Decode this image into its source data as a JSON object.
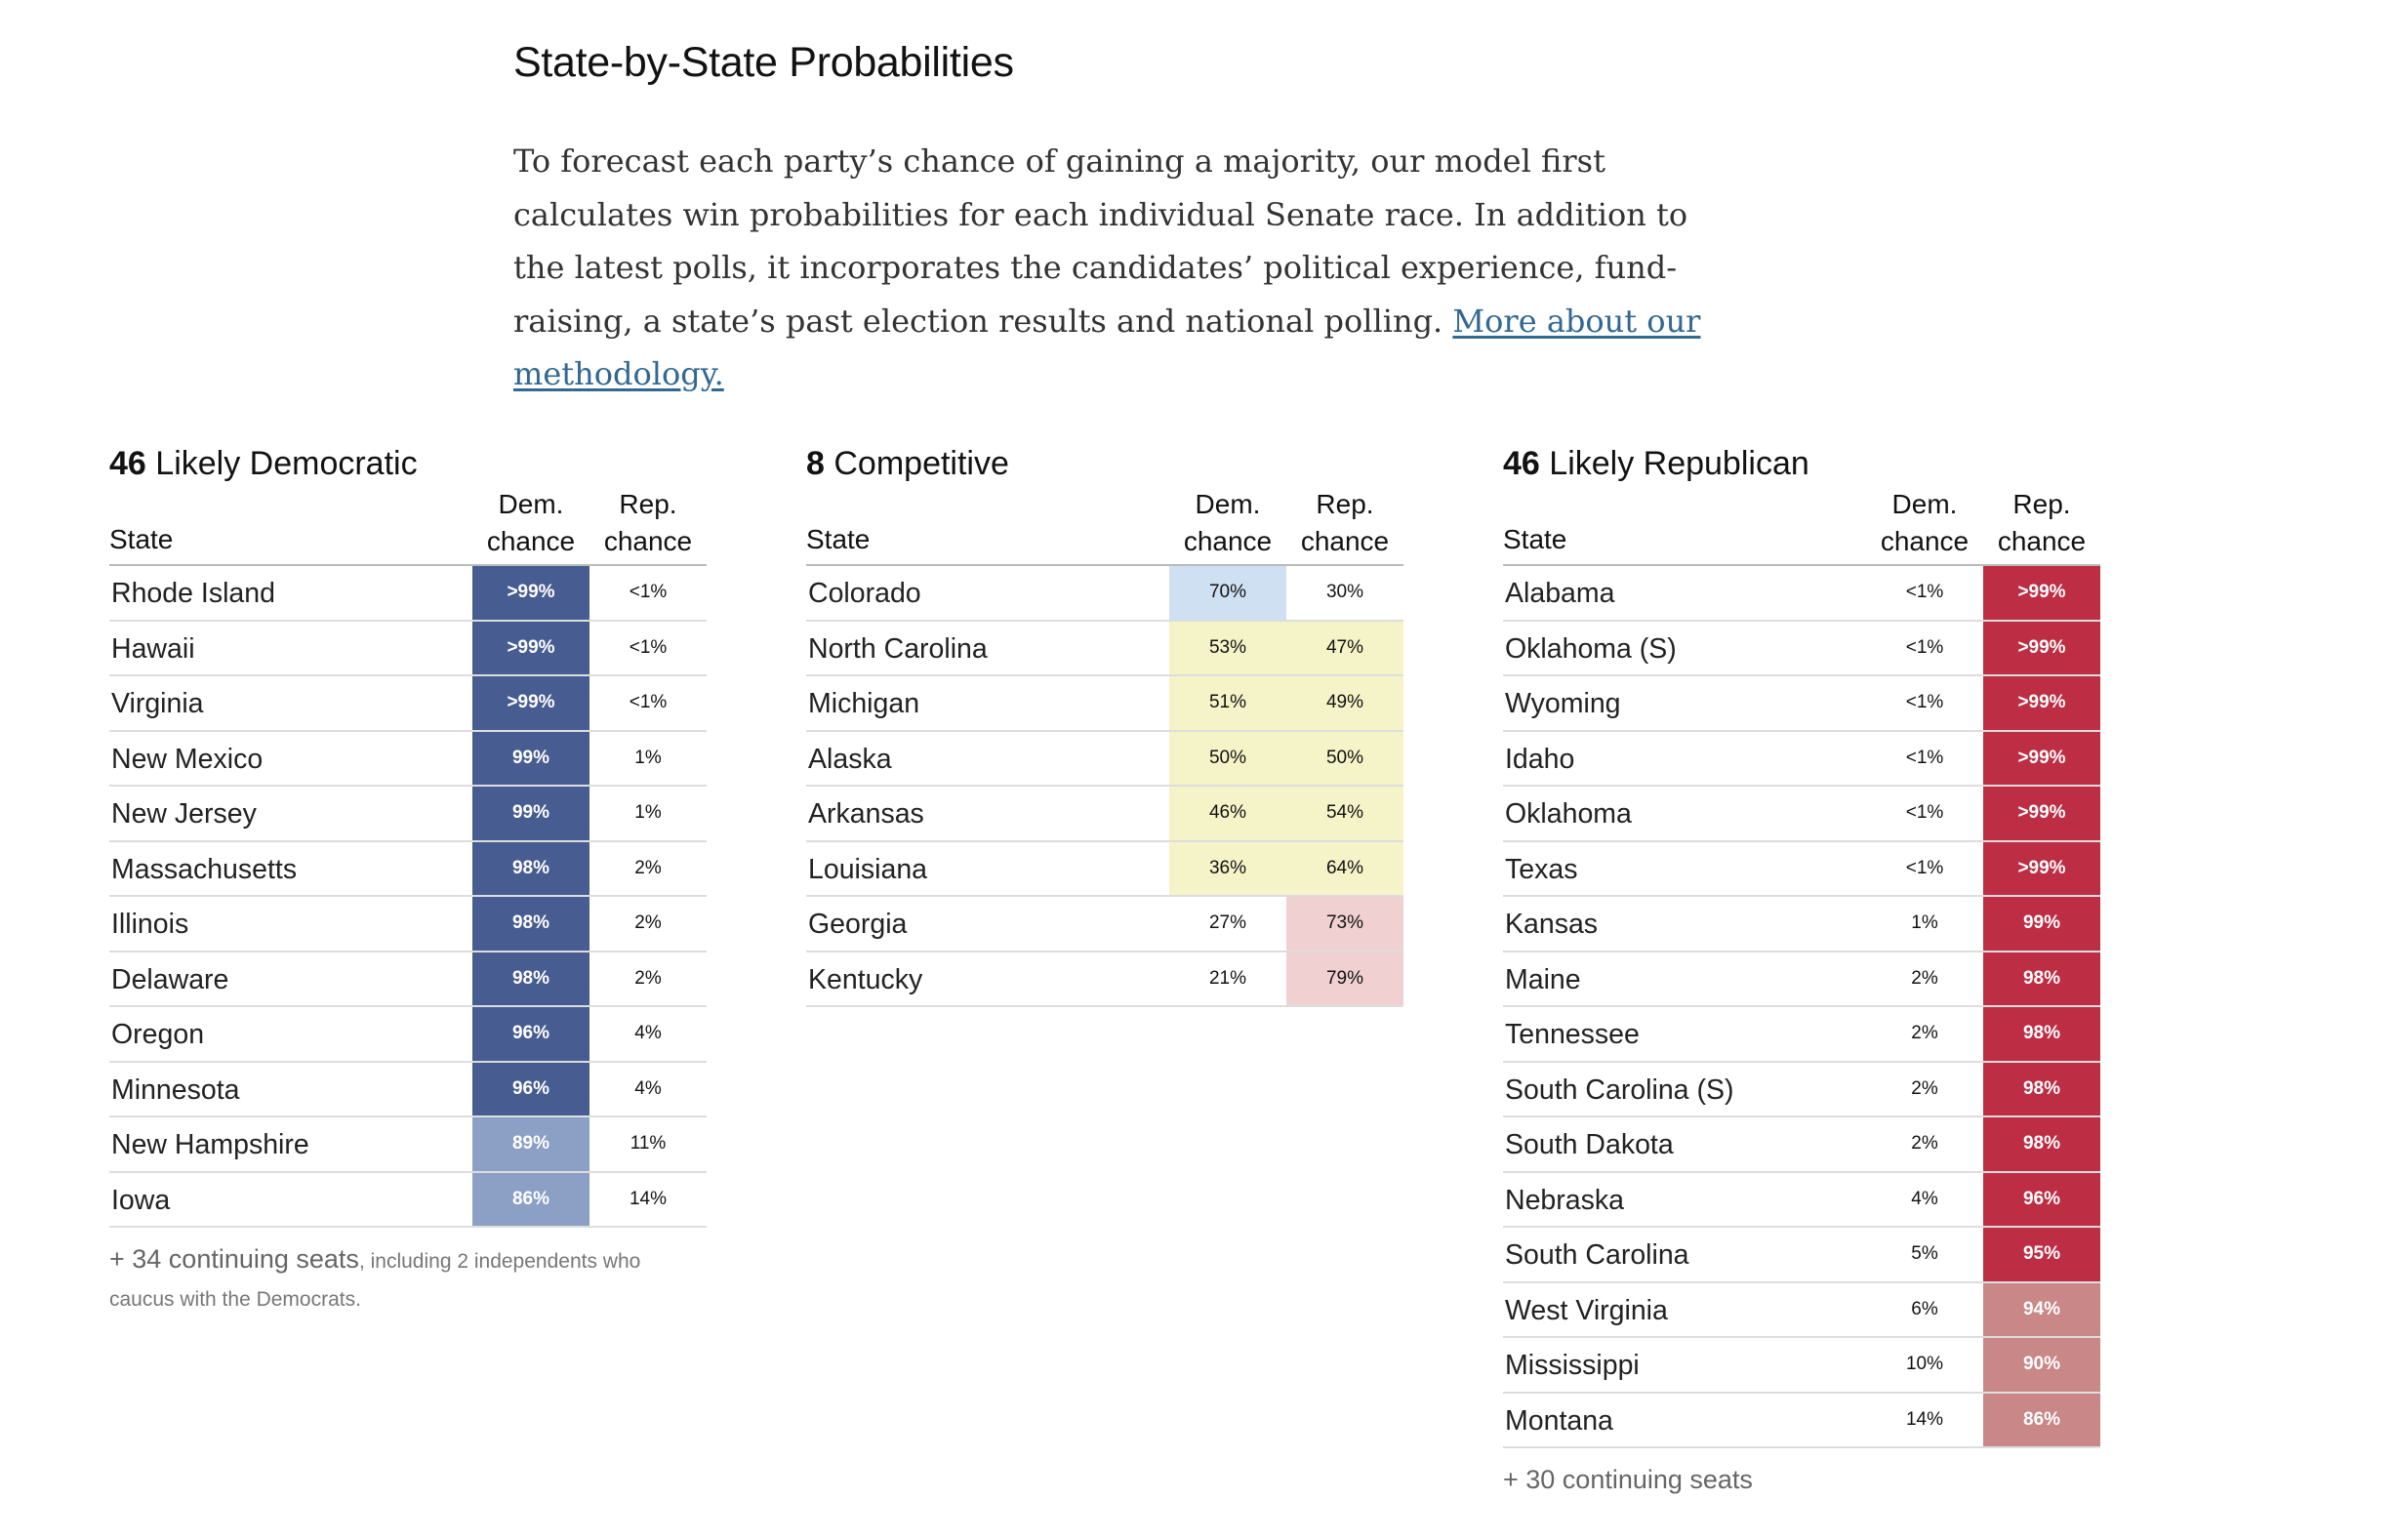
{
  "headline": "State-by-State Probabilities",
  "intro": {
    "text": "To forecast each party’s chance of gaining a majority, our model first calculates win probabilities for each individual Senate race. In addition to the latest polls, it incorporates the candidates’ political experience, fund-raising, a state’s past election results and national polling.",
    "link": "More about our methodology."
  },
  "columns": {
    "state": "State",
    "dem": "Dem. chance",
    "rep": "Rep. chance"
  },
  "colors": {
    "dem_strong": "#475d91",
    "dem_medium": "#8ba0c4",
    "dem_light": "#cfe0f3",
    "tossup": "#f5f3c8",
    "rep_light": "#f1d0d1",
    "rep_medium": "#c98787",
    "rep_strong": "#bd2d43"
  },
  "groups": {
    "dem": {
      "count": "46",
      "label": "Likely Democratic",
      "footnote_main": "+ 34 continuing seats",
      "footnote_small": ", including 2 independents who caucus with the Democrats.",
      "rows": [
        {
          "state": "Rhode Island",
          "dem": ">99%",
          "rep": "<1%",
          "dem_fill": "dem_strong",
          "rep_fill": ""
        },
        {
          "state": "Hawaii",
          "dem": ">99%",
          "rep": "<1%",
          "dem_fill": "dem_strong",
          "rep_fill": ""
        },
        {
          "state": "Virginia",
          "dem": ">99%",
          "rep": "<1%",
          "dem_fill": "dem_strong",
          "rep_fill": ""
        },
        {
          "state": "New Mexico",
          "dem": "99%",
          "rep": "1%",
          "dem_fill": "dem_strong",
          "rep_fill": ""
        },
        {
          "state": "New Jersey",
          "dem": "99%",
          "rep": "1%",
          "dem_fill": "dem_strong",
          "rep_fill": ""
        },
        {
          "state": "Massachusetts",
          "dem": "98%",
          "rep": "2%",
          "dem_fill": "dem_strong",
          "rep_fill": ""
        },
        {
          "state": "Illinois",
          "dem": "98%",
          "rep": "2%",
          "dem_fill": "dem_strong",
          "rep_fill": ""
        },
        {
          "state": "Delaware",
          "dem": "98%",
          "rep": "2%",
          "dem_fill": "dem_strong",
          "rep_fill": ""
        },
        {
          "state": "Oregon",
          "dem": "96%",
          "rep": "4%",
          "dem_fill": "dem_strong",
          "rep_fill": ""
        },
        {
          "state": "Minnesota",
          "dem": "96%",
          "rep": "4%",
          "dem_fill": "dem_strong",
          "rep_fill": ""
        },
        {
          "state": "New Hampshire",
          "dem": "89%",
          "rep": "11%",
          "dem_fill": "dem_medium",
          "rep_fill": ""
        },
        {
          "state": "Iowa",
          "dem": "86%",
          "rep": "14%",
          "dem_fill": "dem_medium",
          "rep_fill": ""
        }
      ]
    },
    "comp": {
      "count": "8",
      "label": "Competitive",
      "footnote_main": "",
      "footnote_small": "",
      "rows": [
        {
          "state": "Colorado",
          "dem": "70%",
          "rep": "30%",
          "dem_fill": "dem_light",
          "rep_fill": ""
        },
        {
          "state": "North Carolina",
          "dem": "53%",
          "rep": "47%",
          "dem_fill": "tossup",
          "rep_fill": "tossup"
        },
        {
          "state": "Michigan",
          "dem": "51%",
          "rep": "49%",
          "dem_fill": "tossup",
          "rep_fill": "tossup"
        },
        {
          "state": "Alaska",
          "dem": "50%",
          "rep": "50%",
          "dem_fill": "tossup",
          "rep_fill": "tossup"
        },
        {
          "state": "Arkansas",
          "dem": "46%",
          "rep": "54%",
          "dem_fill": "tossup",
          "rep_fill": "tossup"
        },
        {
          "state": "Louisiana",
          "dem": "36%",
          "rep": "64%",
          "dem_fill": "tossup",
          "rep_fill": "tossup"
        },
        {
          "state": "Georgia",
          "dem": "27%",
          "rep": "73%",
          "dem_fill": "",
          "rep_fill": "rep_light"
        },
        {
          "state": "Kentucky",
          "dem": "21%",
          "rep": "79%",
          "dem_fill": "",
          "rep_fill": "rep_light"
        }
      ]
    },
    "rep": {
      "count": "46",
      "label": "Likely Republican",
      "footnote_main": "+ 30 continuing seats",
      "footnote_small": "",
      "rows": [
        {
          "state": "Alabama",
          "dem": "<1%",
          "rep": ">99%",
          "dem_fill": "",
          "rep_fill": "rep_strong"
        },
        {
          "state": "Oklahoma (S)",
          "dem": "<1%",
          "rep": ">99%",
          "dem_fill": "",
          "rep_fill": "rep_strong"
        },
        {
          "state": "Wyoming",
          "dem": "<1%",
          "rep": ">99%",
          "dem_fill": "",
          "rep_fill": "rep_strong"
        },
        {
          "state": "Idaho",
          "dem": "<1%",
          "rep": ">99%",
          "dem_fill": "",
          "rep_fill": "rep_strong"
        },
        {
          "state": "Oklahoma",
          "dem": "<1%",
          "rep": ">99%",
          "dem_fill": "",
          "rep_fill": "rep_strong"
        },
        {
          "state": "Texas",
          "dem": "<1%",
          "rep": ">99%",
          "dem_fill": "",
          "rep_fill": "rep_strong"
        },
        {
          "state": "Kansas",
          "dem": "1%",
          "rep": "99%",
          "dem_fill": "",
          "rep_fill": "rep_strong"
        },
        {
          "state": "Maine",
          "dem": "2%",
          "rep": "98%",
          "dem_fill": "",
          "rep_fill": "rep_strong"
        },
        {
          "state": "Tennessee",
          "dem": "2%",
          "rep": "98%",
          "dem_fill": "",
          "rep_fill": "rep_strong"
        },
        {
          "state": "South Carolina (S)",
          "dem": "2%",
          "rep": "98%",
          "dem_fill": "",
          "rep_fill": "rep_strong"
        },
        {
          "state": "South Dakota",
          "dem": "2%",
          "rep": "98%",
          "dem_fill": "",
          "rep_fill": "rep_strong"
        },
        {
          "state": "Nebraska",
          "dem": "4%",
          "rep": "96%",
          "dem_fill": "",
          "rep_fill": "rep_strong"
        },
        {
          "state": "South Carolina",
          "dem": "5%",
          "rep": "95%",
          "dem_fill": "",
          "rep_fill": "rep_strong"
        },
        {
          "state": "West Virginia",
          "dem": "6%",
          "rep": "94%",
          "dem_fill": "",
          "rep_fill": "rep_medium"
        },
        {
          "state": "Mississippi",
          "dem": "10%",
          "rep": "90%",
          "dem_fill": "",
          "rep_fill": "rep_medium"
        },
        {
          "state": "Montana",
          "dem": "14%",
          "rep": "86%",
          "dem_fill": "",
          "rep_fill": "rep_medium"
        }
      ]
    }
  }
}
